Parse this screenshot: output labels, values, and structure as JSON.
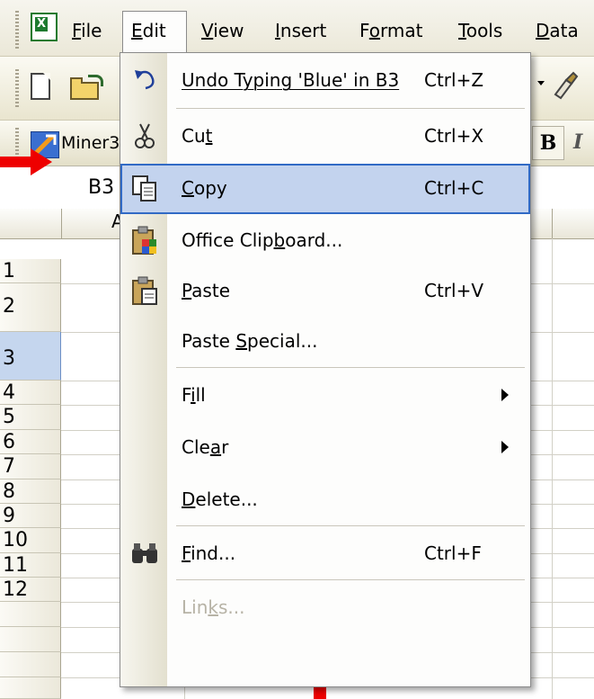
{
  "menubar": {
    "items": [
      {
        "pre": "",
        "key": "F",
        "post": "ile"
      },
      {
        "pre": "",
        "key": "E",
        "post": "dit"
      },
      {
        "pre": "",
        "key": "V",
        "post": "iew"
      },
      {
        "pre": "",
        "key": "I",
        "post": "nsert"
      },
      {
        "pre": "F",
        "key": "o",
        "post": "rmat"
      },
      {
        "pre": "",
        "key": "T",
        "post": "ools"
      },
      {
        "pre": "",
        "key": "D",
        "post": "ata"
      }
    ]
  },
  "toolbar2": {
    "addin_label": "Miner3",
    "bold_label": "B",
    "italic_label": "I"
  },
  "namebox": {
    "value": "B3"
  },
  "sheet": {
    "column_a": "A",
    "rows": [
      "1",
      "2",
      "3",
      "4",
      "5",
      "6",
      "7",
      "8",
      "9",
      "10",
      "11",
      "12"
    ],
    "selected_row": "3"
  },
  "edit_menu": {
    "undo": {
      "label": "Undo Typing 'Blue' in B3",
      "shortcut": "Ctrl+Z"
    },
    "cut": {
      "pre": "Cu",
      "key": "t",
      "post": "",
      "shortcut": "Ctrl+X"
    },
    "copy": {
      "pre": "",
      "key": "C",
      "post": "opy",
      "shortcut": "Ctrl+C"
    },
    "office_clipboard": {
      "pre": "Office Clip",
      "key": "b",
      "post": "oard..."
    },
    "paste": {
      "pre": "",
      "key": "P",
      "post": "aste",
      "shortcut": "Ctrl+V"
    },
    "paste_special": {
      "pre": "Paste ",
      "key": "S",
      "post": "pecial..."
    },
    "fill": {
      "pre": "F",
      "key": "i",
      "post": "ll"
    },
    "clear": {
      "pre": "Cle",
      "key": "a",
      "post": "r"
    },
    "delete": {
      "pre": "",
      "key": "D",
      "post": "elete..."
    },
    "find": {
      "pre": "",
      "key": "F",
      "post": "ind...",
      "shortcut": "Ctrl+F"
    },
    "links": {
      "pre": "Lin",
      "key": "k",
      "post": "s..."
    }
  },
  "colors": {
    "arrow": "#ee0000",
    "highlight": "#c3d3ee",
    "highlight_border": "#316ac5",
    "excel_green": "#1d7a2f"
  }
}
